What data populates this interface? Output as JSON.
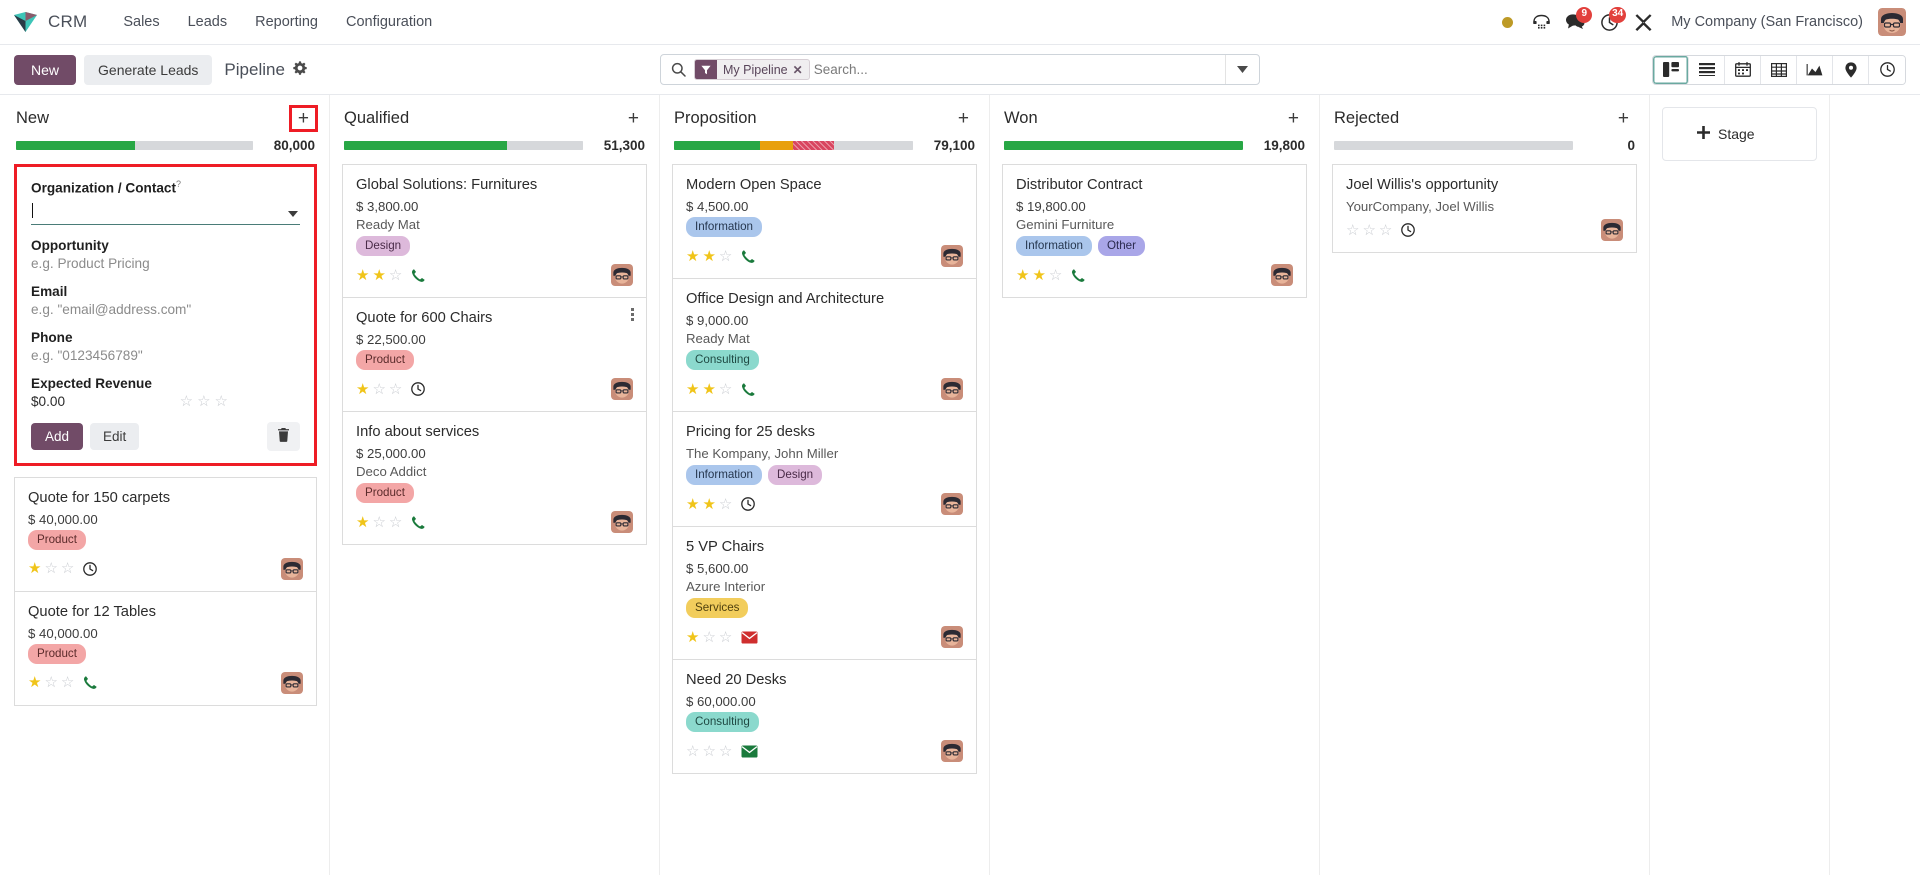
{
  "navbar": {
    "brand": "CRM",
    "menu": [
      "Sales",
      "Leads",
      "Reporting",
      "Configuration"
    ],
    "messages_badge": "9",
    "activities_badge": "34",
    "company": "My Company (San Francisco)"
  },
  "control_panel": {
    "new_label": "New",
    "generate_leads_label": "Generate Leads",
    "breadcrumb": "Pipeline",
    "search": {
      "facet_label": "My Pipeline",
      "placeholder": "Search...",
      "value": ""
    },
    "views": [
      "kanban-view-icon",
      "list-view-icon",
      "calendar-view-icon",
      "pivot-view-icon",
      "graph-view-icon",
      "map-view-icon",
      "activity-view-icon"
    ],
    "active_view": "kanban-view-icon"
  },
  "add_stage_label": "Stage",
  "quick_create": {
    "organization_label": "Organization / Contact",
    "organization_value": "",
    "opportunity_label": "Opportunity",
    "opportunity_placeholder": "e.g. Product Pricing",
    "email_label": "Email",
    "email_placeholder": "e.g. \"email@address.com\"",
    "phone_label": "Phone",
    "phone_placeholder": "e.g. \"0123456789\"",
    "revenue_label": "Expected Revenue",
    "revenue_value": "$0.00",
    "revenue_priority": 0,
    "add_label": "Add",
    "edit_label": "Edit",
    "delete_icon": "trash-icon"
  },
  "columns": [
    {
      "title": "New",
      "amount": "80,000",
      "plus_highlighted": true,
      "segments": [
        {
          "color": "green",
          "pct": 50
        },
        {
          "color": "grey",
          "pct": 50
        }
      ],
      "has_quick_create": true,
      "cards": [
        {
          "title": "Quote for 150 carpets",
          "amount": "$ 40,000.00",
          "partner": "",
          "tags": [
            {
              "label": "Product",
              "color": "pink"
            }
          ],
          "stars": 1,
          "activity": "clock"
        },
        {
          "title": "Quote for 12 Tables",
          "amount": "$ 40,000.00",
          "partner": "",
          "tags": [
            {
              "label": "Product",
              "color": "pink"
            }
          ],
          "stars": 1,
          "activity": "phone"
        }
      ]
    },
    {
      "title": "Qualified",
      "amount": "51,300",
      "plus_highlighted": false,
      "segments": [
        {
          "color": "green",
          "pct": 68
        },
        {
          "color": "grey",
          "pct": 32
        }
      ],
      "has_quick_create": false,
      "cards": [
        {
          "title": "Global Solutions: Furnitures",
          "amount": "$ 3,800.00",
          "partner": "Ready Mat",
          "tags": [
            {
              "label": "Design",
              "color": "purple"
            }
          ],
          "stars": 2,
          "activity": "phone"
        },
        {
          "title": "Quote for 600 Chairs",
          "amount": "$ 22,500.00",
          "partner": "",
          "tags": [
            {
              "label": "Product",
              "color": "pink"
            }
          ],
          "stars": 1,
          "activity": "clock",
          "kebab": true
        },
        {
          "title": "Info about services",
          "amount": "$ 25,000.00",
          "partner": "Deco Addict",
          "tags": [
            {
              "label": "Product",
              "color": "pink"
            }
          ],
          "stars": 1,
          "activity": "phone"
        }
      ]
    },
    {
      "title": "Proposition",
      "amount": "79,100",
      "plus_highlighted": false,
      "segments": [
        {
          "color": "green",
          "pct": 36
        },
        {
          "color": "orange",
          "pct": 14
        },
        {
          "color": "red",
          "pct": 17
        },
        {
          "color": "grey",
          "pct": 33
        }
      ],
      "has_quick_create": false,
      "cards": [
        {
          "title": "Modern Open Space",
          "amount": "$ 4,500.00",
          "partner": "",
          "tags": [
            {
              "label": "Information",
              "color": "blue"
            }
          ],
          "stars": 2,
          "activity": "phone"
        },
        {
          "title": "Office Design and Architecture",
          "amount": "$ 9,000.00",
          "partner": "Ready Mat",
          "tags": [
            {
              "label": "Consulting",
              "color": "teal"
            }
          ],
          "stars": 2,
          "activity": "phone"
        },
        {
          "title": "Pricing for 25 desks",
          "amount": "",
          "partner": "The Kompany, John Miller",
          "tags": [
            {
              "label": "Information",
              "color": "blue"
            },
            {
              "label": "Design",
              "color": "purple"
            }
          ],
          "stars": 2,
          "activity": "clock"
        },
        {
          "title": "5 VP Chairs",
          "amount": "$ 5,600.00",
          "partner": "Azure Interior",
          "tags": [
            {
              "label": "Services",
              "color": "yellow"
            }
          ],
          "stars": 1,
          "activity": "mail-red"
        },
        {
          "title": "Need 20 Desks",
          "amount": "$ 60,000.00",
          "partner": "",
          "tags": [
            {
              "label": "Consulting",
              "color": "teal"
            }
          ],
          "stars": 0,
          "activity": "mail-green"
        }
      ]
    },
    {
      "title": "Won",
      "amount": "19,800",
      "plus_highlighted": false,
      "segments": [
        {
          "color": "green",
          "pct": 100
        }
      ],
      "has_quick_create": false,
      "cards": [
        {
          "title": "Distributor Contract",
          "amount": "$ 19,800.00",
          "partner": "Gemini Furniture",
          "tags": [
            {
              "label": "Information",
              "color": "blue"
            },
            {
              "label": "Other",
              "color": "violet"
            }
          ],
          "stars": 2,
          "activity": "phone"
        }
      ]
    },
    {
      "title": "Rejected",
      "amount": "0",
      "plus_highlighted": false,
      "segments": [
        {
          "color": "grey",
          "pct": 100
        }
      ],
      "has_quick_create": false,
      "cards": [
        {
          "title": "Joel Willis's opportunity",
          "amount": "",
          "partner": "YourCompany, Joel Willis",
          "tags": [],
          "stars": 0,
          "activity": "clock"
        }
      ]
    }
  ]
}
